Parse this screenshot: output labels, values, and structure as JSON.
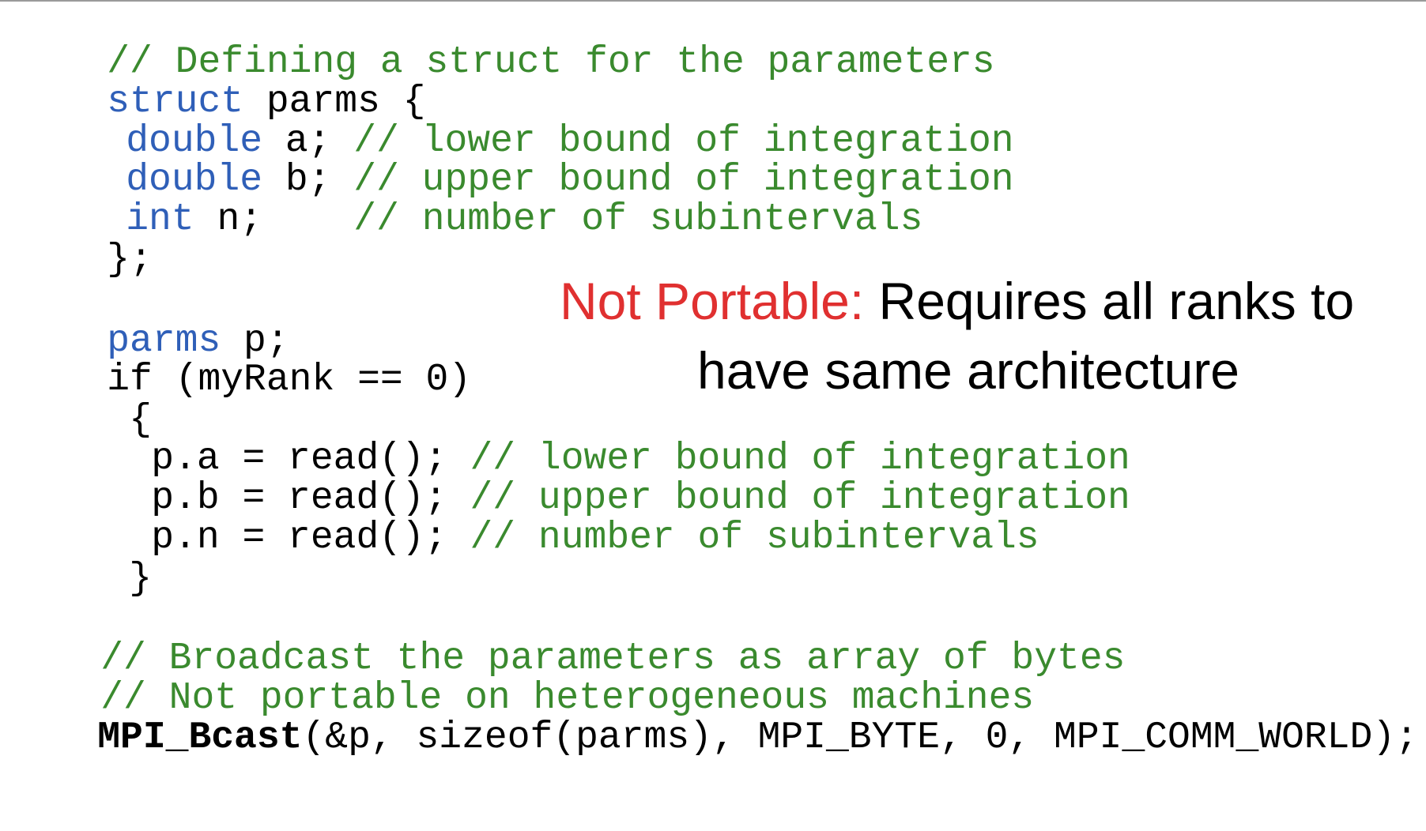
{
  "code": {
    "line1_comment": "// Defining a struct for the parameters",
    "line2_kw": "struct",
    "line2_rest": " parms {",
    "line3_kw": "double",
    "line3_mid": " a; ",
    "line3_comment": "// lower bound of integration",
    "line4_kw": "double",
    "line4_mid": " b; ",
    "line4_comment": "// upper bound of integration",
    "line5_kw": "int",
    "line5_mid": " n;    ",
    "line5_comment": "// number of subintervals",
    "line6": "};",
    "line7_kw": "parms",
    "line7_rest": " p;",
    "line8": "if (myRank == 0)",
    "line9": "{",
    "line10_code": "p.a = read(); ",
    "line10_comment": "// lower bound of integration",
    "line11_code": "p.b = read(); ",
    "line11_comment": "// upper bound of integration",
    "line12_code": "p.n = read(); ",
    "line12_comment": "// number of subintervals",
    "line13": "}",
    "line14_comment": "// Broadcast the parameters as array of bytes",
    "line15_comment": "// Not portable on heterogeneous machines",
    "line16_func": "MPI_Bcast",
    "line16_rest": "(&p, sizeof(parms), MPI_BYTE, 0, MPI_COMM_WORLD);"
  },
  "note": {
    "label": "Not Portable:",
    "line1": " Requires all ranks to",
    "line2": "have same architecture"
  },
  "colors": {
    "comment": "#3a8a2e",
    "keyword": "#2f5fb8",
    "warning": "#e03030",
    "text": "#000000"
  }
}
